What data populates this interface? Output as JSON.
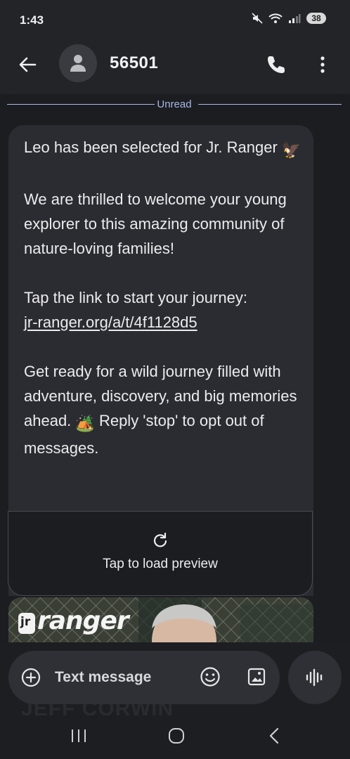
{
  "status_bar": {
    "time": "1:43",
    "battery": "38",
    "network": "5"
  },
  "header": {
    "contact": "56501"
  },
  "conversation": {
    "unread_label": "Unread",
    "message": {
      "line1": "Leo has been selected for Jr. Ranger",
      "line1_emoji": "🦅",
      "para2": "We are thrilled to welcome your young explorer to this amazing community of nature-loving families!",
      "para3_text": "Tap the link to start your journey:",
      "para3_link": "jr-ranger.org/a/t/4f1128d5",
      "para4_a": "Get ready for a wild journey filled with adventure, discovery, and big memories ahead.",
      "para4_emoji": "🏕️",
      "para4_b": "Reply 'stop' to opt out of messages."
    },
    "preview": {
      "label": "Tap to load preview"
    },
    "image": {
      "logo_prefix": "jr",
      "logo_text": "ranger"
    }
  },
  "composer": {
    "placeholder": "Text message"
  },
  "background_watermark": "JEFF CORWIN",
  "colors": {
    "background": "#1c1d21",
    "bubble": "#2b2c31",
    "accent": "#a9b8e6"
  }
}
